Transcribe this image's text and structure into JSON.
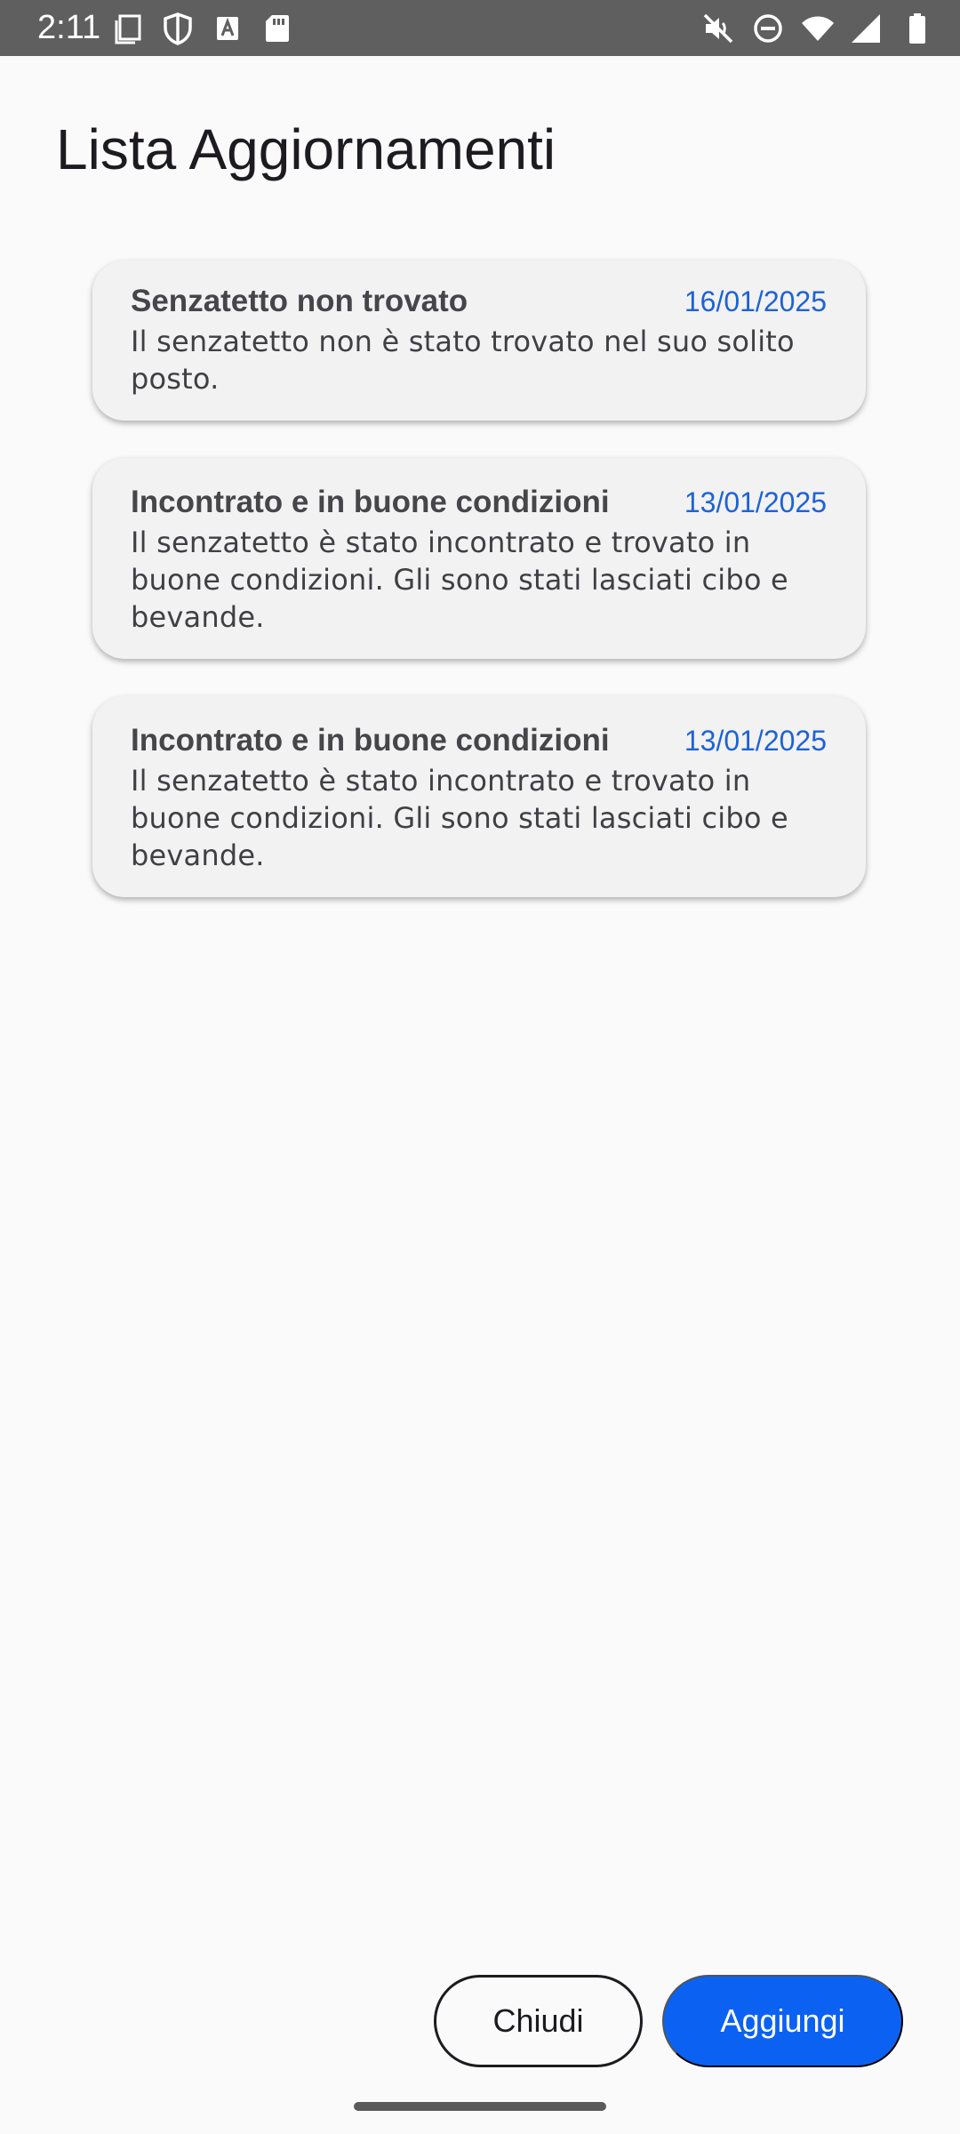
{
  "status_bar": {
    "time": "2:11",
    "left_icons": [
      "screenshot-icon",
      "shield-icon",
      "font-a-icon",
      "sd-card-icon"
    ],
    "right_icons": [
      "mute-icon",
      "do-not-disturb-icon",
      "wifi-icon",
      "signal-icon",
      "battery-icon"
    ]
  },
  "page": {
    "title": "Lista Aggiornamenti"
  },
  "updates": [
    {
      "title": "Senzatetto non trovato",
      "date": "16/01/2025",
      "body": "Il senzatetto non è stato trovato nel suo solito posto."
    },
    {
      "title": "Incontrato e in buone condizioni",
      "date": "13/01/2025",
      "body": "Il senzatetto è stato incontrato e trovato in buone condizioni. Gli sono stati lasciati cibo e bevande."
    },
    {
      "title": "Incontrato e in buone condizioni",
      "date": "13/01/2025",
      "body": "Il senzatetto è stato incontrato e trovato in buone condizioni. Gli sono stati lasciati cibo e bevande."
    }
  ],
  "actions": {
    "close_label": "Chiudi",
    "add_label": "Aggiungi"
  },
  "colors": {
    "accent": "#0b62f2",
    "date": "#1d62d8",
    "card_bg": "#f2f2f2",
    "status_bar": "#5f5f5f"
  }
}
